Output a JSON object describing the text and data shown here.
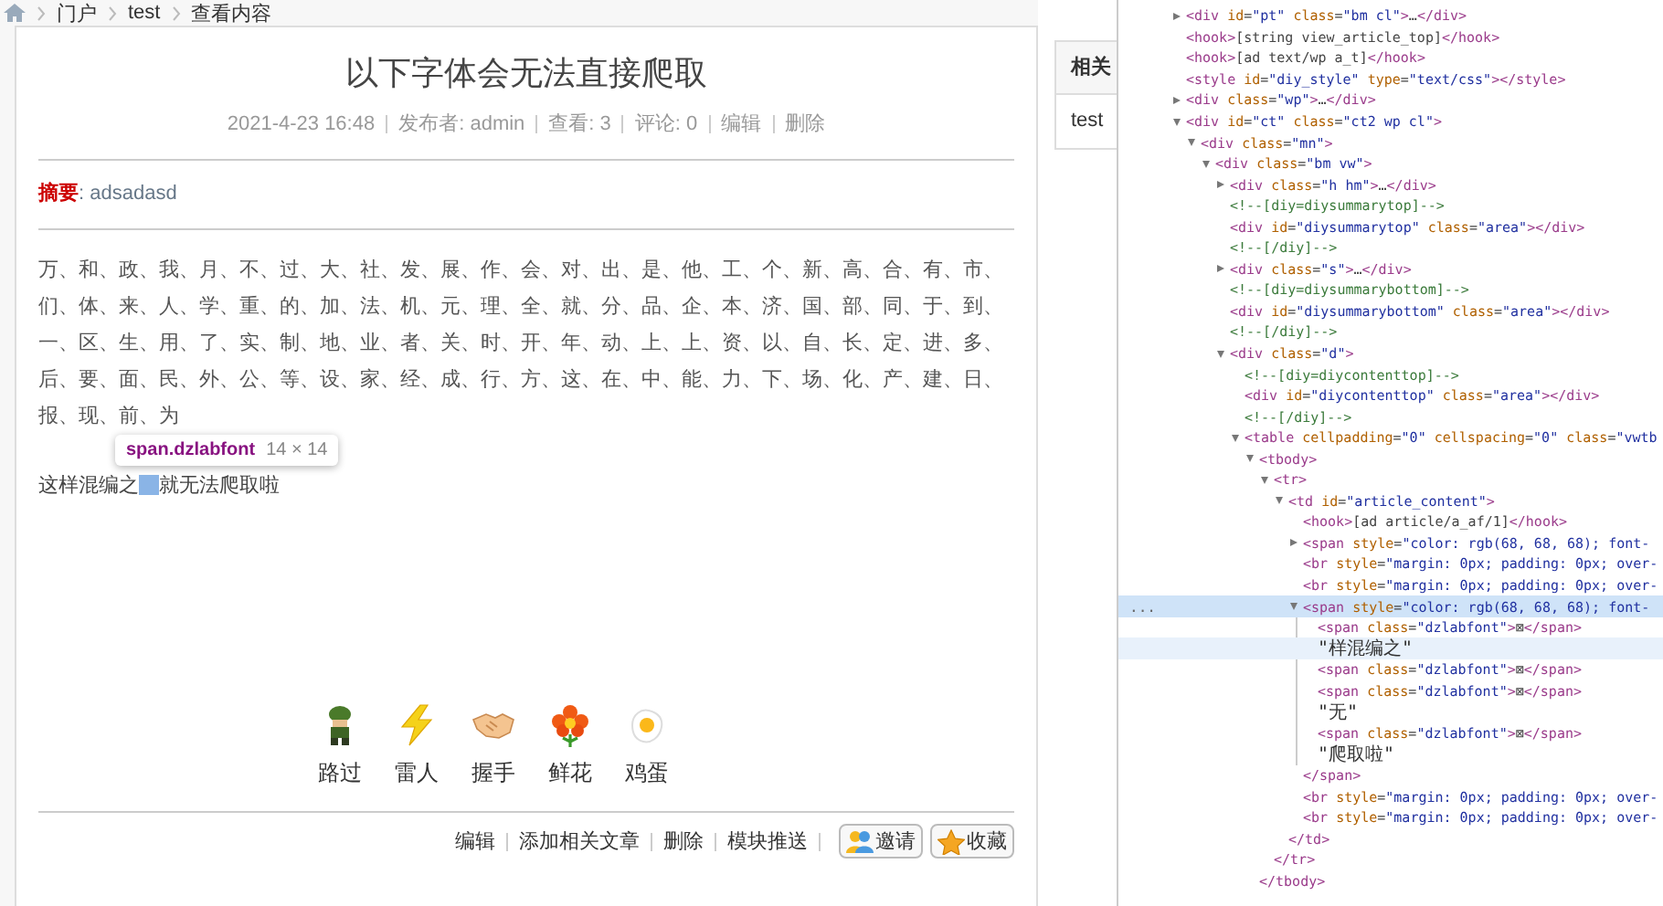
{
  "breadcrumb": {
    "items": [
      "门户",
      "test",
      "查看内容"
    ]
  },
  "article": {
    "title": "以下字体会无法直接爬取",
    "meta": [
      "2021-4-23 16:48",
      "发布者: admin",
      "查看: 3",
      "评论: 0",
      "编辑",
      "删除"
    ],
    "summary": {
      "label": "摘要",
      "text": ": adsadasd"
    },
    "char_lines": [
      "万、和、政、我、月、不、过、大、社、发、展、作、会、对、出、是、他、工、个、新、高、合、有、市、",
      "们、体、来、人、学、重、的、加、法、机、元、理、全、就、分、品、企、本、济、国、部、同、于、到、",
      "一、区、生、用、了、实、制、地、业、者、关、时、开、年、动、上、上、资、以、自、长、定、进、多、",
      "后、要、面、民、外、公、等、设、家、经、成、行、方、这、在、中、能、力、下、场、化、产、建、日、",
      "报、现、前、为"
    ],
    "mixed_line": {
      "before": "这样混编之",
      "after": "就无法爬取啦"
    },
    "tooltip": {
      "selector": "span.dzlabfont",
      "size": "14 × 14"
    },
    "reactions": [
      {
        "label": "路过",
        "kind": "soldier"
      },
      {
        "label": "雷人",
        "kind": "lightning"
      },
      {
        "label": "握手",
        "kind": "handshake"
      },
      {
        "label": "鲜花",
        "kind": "flower"
      },
      {
        "label": "鸡蛋",
        "kind": "egg"
      }
    ],
    "actions": [
      {
        "text": "编辑",
        "kind": "link"
      },
      {
        "text": "添加相关文章",
        "kind": "link"
      },
      {
        "text": "删除",
        "kind": "link"
      },
      {
        "text": "模块推送",
        "kind": "link"
      },
      {
        "text": "邀请",
        "kind": "invite"
      },
      {
        "text": "收藏",
        "kind": "favorite"
      }
    ]
  },
  "sidebar": {
    "title": "相关",
    "items": [
      "test"
    ]
  },
  "devtools": {
    "selection_marker": "...",
    "nodes": [
      {
        "text": "<div id=\"pt\" class=\"bm cl\">…</div>",
        "kind": "tag",
        "expanded": false,
        "selected": false,
        "hovered": false
      },
      {
        "text": "<hook>[string view_article_top]</hook>",
        "kind": "tag",
        "selected": false,
        "hovered": false
      },
      {
        "text": "<hook>[ad text/wp a_t]</hook>",
        "kind": "tag",
        "selected": false,
        "hovered": false
      },
      {
        "text": "<style id=\"diy_style\" type=\"text/css\"></style>",
        "kind": "tag",
        "selected": false,
        "hovered": false
      },
      {
        "text": "<div class=\"wp\">…</div>",
        "kind": "tag",
        "expanded": false,
        "selected": false,
        "hovered": false
      },
      {
        "text": "<div id=\"ct\" class=\"ct2 wp cl\">",
        "kind": "tag",
        "expanded": true,
        "selected": false,
        "hovered": false,
        "children": [
          {
            "text": "<div class=\"mn\">",
            "kind": "tag",
            "expanded": true,
            "selected": false,
            "hovered": false,
            "children": [
              {
                "text": "<div class=\"bm vw\">",
                "kind": "tag",
                "expanded": true,
                "selected": false,
                "hovered": false,
                "children": [
                  {
                    "text": "<div class=\"h hm\">…</div>",
                    "kind": "tag",
                    "expanded": false,
                    "selected": false,
                    "hovered": false
                  },
                  {
                    "text": "<!--[diy=diysummarytop]-->",
                    "kind": "comment",
                    "selected": false,
                    "hovered": false
                  },
                  {
                    "text": "<div id=\"diysummarytop\" class=\"area\"></div>",
                    "kind": "tag",
                    "selected": false,
                    "hovered": false
                  },
                  {
                    "text": "<!--[/diy]-->",
                    "kind": "comment",
                    "selected": false,
                    "hovered": false
                  },
                  {
                    "text": "<div class=\"s\">…</div>",
                    "kind": "tag",
                    "expanded": false,
                    "selected": false,
                    "hovered": false
                  },
                  {
                    "text": "<!--[diy=diysummarybottom]-->",
                    "kind": "comment",
                    "selected": false,
                    "hovered": false
                  },
                  {
                    "text": "<div id=\"diysummarybottom\" class=\"area\"></div>",
                    "kind": "tag",
                    "selected": false,
                    "hovered": false
                  },
                  {
                    "text": "<!--[/diy]-->",
                    "kind": "comment",
                    "selected": false,
                    "hovered": false
                  },
                  {
                    "text": "<div class=\"d\">",
                    "kind": "tag",
                    "expanded": true,
                    "selected": false,
                    "hovered": false,
                    "children": [
                      {
                        "text": "<!--[diy=diycontenttop]-->",
                        "kind": "comment",
                        "selected": false,
                        "hovered": false
                      },
                      {
                        "text": "<div id=\"diycontenttop\" class=\"area\"></div>",
                        "kind": "tag",
                        "selected": false,
                        "hovered": false
                      },
                      {
                        "text": "<!--[/diy]-->",
                        "kind": "comment",
                        "selected": false,
                        "hovered": false
                      },
                      {
                        "text": "<table cellpadding=\"0\" cellspacing=\"0\" class=\"vwtb",
                        "kind": "tag",
                        "expanded": true,
                        "selected": false,
                        "hovered": false,
                        "children": [
                          {
                            "text": "<tbody>",
                            "kind": "tag",
                            "expanded": true,
                            "selected": false,
                            "hovered": false,
                            "close": "</tbody>",
                            "children": [
                              {
                                "text": "<tr>",
                                "kind": "tag",
                                "expanded": true,
                                "selected": false,
                                "hovered": false,
                                "close": "</tr>",
                                "children": [
                                  {
                                    "text": "<td id=\"article_content\">",
                                    "kind": "tag",
                                    "expanded": true,
                                    "selected": false,
                                    "hovered": false,
                                    "close": "</td>",
                                    "children": [
                                      {
                                        "text": "<hook>[ad article/a_af/1]</hook>",
                                        "kind": "tag",
                                        "selected": false,
                                        "hovered": false
                                      },
                                      {
                                        "text": "<span style=\"color: rgb(68, 68, 68); font-",
                                        "kind": "tag",
                                        "expanded": false,
                                        "selected": false,
                                        "hovered": false
                                      },
                                      {
                                        "text": "<br style=\"margin: 0px; padding: 0px; over-",
                                        "kind": "tag",
                                        "selected": false,
                                        "hovered": false
                                      },
                                      {
                                        "text": "<br style=\"margin: 0px; padding: 0px; over-",
                                        "kind": "tag",
                                        "selected": false,
                                        "hovered": false
                                      },
                                      {
                                        "text": "<span style=\"color: rgb(68, 68, 68); font-",
                                        "kind": "tag",
                                        "expanded": true,
                                        "selected": true,
                                        "hovered": false,
                                        "close": "</span>",
                                        "children": [
                                          {
                                            "text": "<span class=\"dzlabfont\">⊠</span>",
                                            "kind": "tag",
                                            "selected": false,
                                            "hovered": false
                                          },
                                          {
                                            "text": "\"样混编之\"",
                                            "kind": "text",
                                            "selected": false,
                                            "hovered": true
                                          },
                                          {
                                            "text": "<span class=\"dzlabfont\">⊠</span>",
                                            "kind": "tag",
                                            "selected": false,
                                            "hovered": false
                                          },
                                          {
                                            "text": "<span class=\"dzlabfont\">⊠</span>",
                                            "kind": "tag",
                                            "selected": false,
                                            "hovered": false
                                          },
                                          {
                                            "text": "\"无\"",
                                            "kind": "text",
                                            "selected": false,
                                            "hovered": false
                                          },
                                          {
                                            "text": "<span class=\"dzlabfont\">⊠</span>",
                                            "kind": "tag",
                                            "selected": false,
                                            "hovered": false
                                          },
                                          {
                                            "text": "\"爬取啦\"",
                                            "kind": "text",
                                            "selected": false,
                                            "hovered": false
                                          }
                                        ]
                                      },
                                      {
                                        "text": "<br style=\"margin: 0px; padding: 0px; over-",
                                        "kind": "tag",
                                        "selected": false,
                                        "hovered": false
                                      },
                                      {
                                        "text": "<br style=\"margin: 0px; padding: 0px; over-",
                                        "kind": "tag",
                                        "selected": false,
                                        "hovered": false
                                      }
                                    ]
                                  }
                                ]
                              }
                            ]
                          }
                        ]
                      }
                    ]
                  }
                ]
              }
            ]
          }
        ]
      }
    ]
  }
}
